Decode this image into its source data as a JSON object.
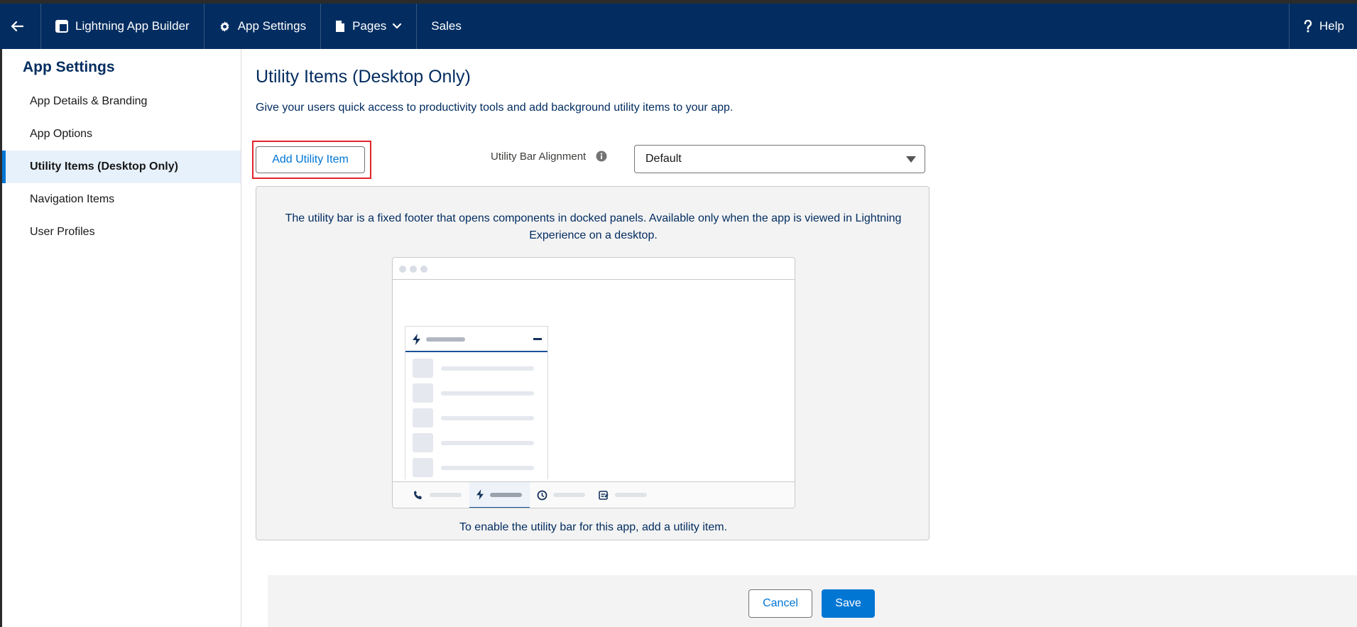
{
  "topbar": {
    "app_builder_label": "Lightning App Builder",
    "app_settings_label": "App Settings",
    "pages_label": "Pages",
    "app_name": "Sales",
    "help_label": "Help",
    "background_color": "#032d60"
  },
  "sidebar": {
    "title": "App Settings",
    "items": [
      {
        "label": "App Details & Branding"
      },
      {
        "label": "App Options"
      },
      {
        "label": "Utility Items (Desktop Only)",
        "active": true
      },
      {
        "label": "Navigation Items"
      },
      {
        "label": "User Profiles"
      }
    ]
  },
  "main": {
    "title": "Utility Items (Desktop Only)",
    "description": "Give your users quick access to productivity tools and add background utility items to your app.",
    "add_button_label": "Add Utility Item",
    "alignment_label": "Utility Bar Alignment",
    "alignment_value": "Default",
    "info_text": "The utility bar is a fixed footer that opens components in docked panels. Available only when the app is viewed in Lightning Experience on a desktop.",
    "info_footer": "To enable the utility bar for this app, add a utility item."
  },
  "footer": {
    "cancel_label": "Cancel",
    "save_label": "Save"
  },
  "colors": {
    "brand_blue": "#0176d3",
    "navy": "#032d60",
    "highlight_red": "#e0252b"
  }
}
